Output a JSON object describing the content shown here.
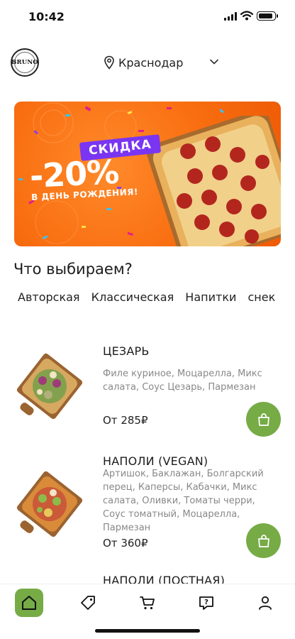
{
  "status_bar": {
    "time": "10:42"
  },
  "header": {
    "logo_name": "BRUNO",
    "city": "Краснодар"
  },
  "banner": {
    "tag": "СКИДКА",
    "discount": "-20%",
    "caption": "В ДЕНЬ РОЖДЕНИЯ!"
  },
  "section_title": "Что выбираем?",
  "tabs": [
    "Авторская",
    "Классическая",
    "Напитки",
    "снек"
  ],
  "products": [
    {
      "title": "ЦЕЗАРЬ",
      "description": "Филе куриное, Моцарелла, Микс салата, Соус Цезарь, Пармезан",
      "price": "От 285₽"
    },
    {
      "title": "НАПОЛИ (VEGAN)",
      "description": "Артишок, Баклажан, Болгарский перец, Каперсы, Кабачки, Микс салата, Оливки, Томаты черри, Соус томатный, Моцарелла, Пармезан",
      "price": "От 360₽"
    },
    {
      "title": "НАПОЛИ (ПОСТНАЯ)"
    }
  ],
  "nav": [
    "home-icon",
    "tag-icon",
    "cart-icon",
    "help-icon",
    "profile-icon"
  ],
  "colors": {
    "accent": "#76ab46",
    "banner": "#f86d10",
    "promo_tag": "#7a35f2"
  }
}
